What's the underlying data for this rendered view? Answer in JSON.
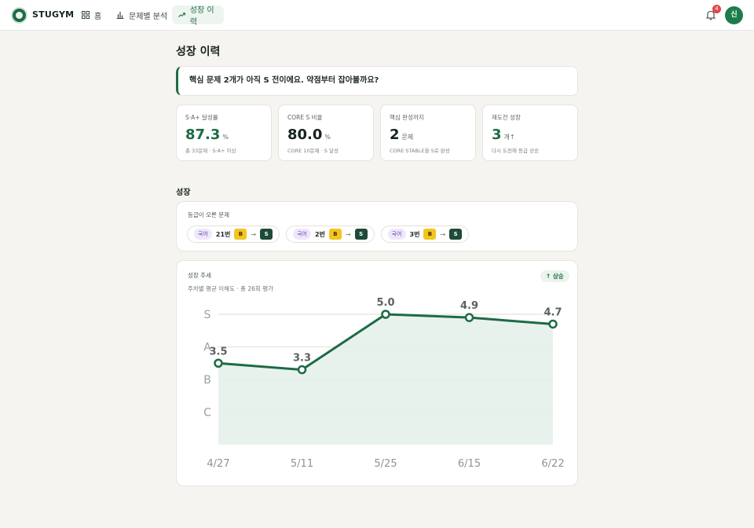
{
  "nav": {
    "brand": "STUGYM",
    "items": [
      {
        "label": "홈"
      },
      {
        "label": "문제별 분석"
      },
      {
        "label": "성장 이력"
      }
    ],
    "notification_count": "4",
    "avatar_initial": "신"
  },
  "page": {
    "title": "성장 이력",
    "notice": "핵심 문제 2개가 아직 S 전이에요. 약점부터 잡아볼까요?"
  },
  "stats": [
    {
      "label": "S·A+ 달성률",
      "value": "87.3",
      "unit": "%",
      "sub": "총 33문제 · S·A+ 이상"
    },
    {
      "label": "CORE S 비율",
      "value": "80.0",
      "unit": "%",
      "sub": "CORE 10문제 · S 달성"
    },
    {
      "label": "핵심 완성까지",
      "value": "2",
      "unit": "문제",
      "sub": "CORE·STABLE을 S로 완성"
    },
    {
      "label": "재도전 성장",
      "value": "3",
      "unit": "개↑",
      "sub": "다시 도전해 등급 상승"
    }
  ],
  "growth": {
    "section_title": "성장",
    "grade_up": {
      "title": "등급이 오른 문제",
      "items": [
        {
          "subject": "국어",
          "number": "21번",
          "from": "B",
          "to": "S"
        },
        {
          "subject": "국어",
          "number": "2번",
          "from": "B",
          "to": "S"
        },
        {
          "subject": "국어",
          "number": "3번",
          "from": "B",
          "to": "S"
        }
      ]
    },
    "trend": {
      "title": "성장 추세",
      "subtitle": "주차별 평균 이해도 · 총 26회 평가",
      "badge": "↑ 상승"
    }
  },
  "colors": {
    "accent": "#1d6b45",
    "area_fill": "#e4f0ea",
    "grade_b": "#f2c521",
    "grade_s": "#1f4a38",
    "subject_bg": "#efe7fb"
  },
  "chart_data": {
    "type": "area",
    "x": [
      "4/27",
      "5/11",
      "5/25",
      "6/15",
      "6/22"
    ],
    "values": [
      3.5,
      3.3,
      5.0,
      4.9,
      4.7
    ],
    "y_tick_labels": [
      {
        "label": "S",
        "value": 5
      },
      {
        "label": "A",
        "value": 4
      },
      {
        "label": "B",
        "value": 3
      },
      {
        "label": "C",
        "value": 2
      }
    ],
    "ylim": [
      1,
      5
    ],
    "grid": true,
    "data_labels": true
  }
}
